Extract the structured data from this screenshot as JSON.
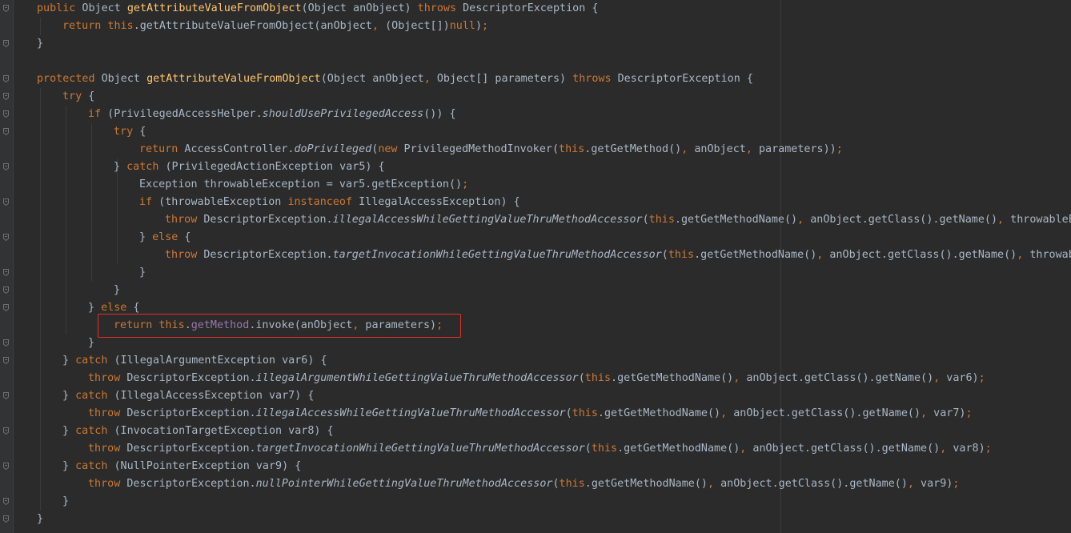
{
  "editor": {
    "colors": {
      "background": "#2b2b2b",
      "gutter": "#313335",
      "keyword": "#cc7832",
      "method_declaration": "#ffc66d",
      "field": "#9876aa",
      "text": "#a9b7c6",
      "highlight_box": "#e0302a"
    },
    "fold_icons": [
      "fold-marker-icon"
    ],
    "lines": [
      {
        "tokens": [
          {
            "t": "kw",
            "v": "public"
          },
          {
            "t": "tx",
            "v": " Object "
          },
          {
            "t": "fn",
            "v": "getAttributeValueFromObject"
          },
          {
            "t": "tx",
            "v": "(Object anObject) "
          },
          {
            "t": "kw",
            "v": "throws"
          },
          {
            "t": "tx",
            "v": " DescriptorException {"
          }
        ]
      },
      {
        "tokens": [
          {
            "t": "kw",
            "v": "return this"
          },
          {
            "t": "tx",
            "v": ".getAttributeValueFromObject(anObject"
          },
          {
            "t": "kw",
            "v": ","
          },
          {
            "t": "tx",
            "v": " (Object[])"
          },
          {
            "t": "kw",
            "v": "null"
          },
          {
            "t": "tx",
            "v": ")"
          },
          {
            "t": "kw",
            "v": ";"
          }
        ]
      },
      {
        "tokens": [
          {
            "t": "tx",
            "v": "}"
          }
        ]
      },
      {
        "tokens": []
      },
      {
        "tokens": [
          {
            "t": "kw",
            "v": "protected"
          },
          {
            "t": "tx",
            "v": " Object "
          },
          {
            "t": "fn",
            "v": "getAttributeValueFromObject"
          },
          {
            "t": "tx",
            "v": "(Object anObject"
          },
          {
            "t": "kw",
            "v": ","
          },
          {
            "t": "tx",
            "v": " Object[] parameters) "
          },
          {
            "t": "kw",
            "v": "throws"
          },
          {
            "t": "tx",
            "v": " DescriptorException {"
          }
        ]
      },
      {
        "tokens": [
          {
            "t": "kw",
            "v": "try"
          },
          {
            "t": "tx",
            "v": " {"
          }
        ]
      },
      {
        "tokens": [
          {
            "t": "kw",
            "v": "if"
          },
          {
            "t": "tx",
            "v": " (PrivilegedAccessHelper."
          },
          {
            "t": "st",
            "v": "shouldUsePrivilegedAccess"
          },
          {
            "t": "tx",
            "v": "()) {"
          }
        ]
      },
      {
        "tokens": [
          {
            "t": "kw",
            "v": "try"
          },
          {
            "t": "tx",
            "v": " {"
          }
        ]
      },
      {
        "tokens": [
          {
            "t": "kw",
            "v": "return"
          },
          {
            "t": "tx",
            "v": " AccessController."
          },
          {
            "t": "st",
            "v": "doPrivileged"
          },
          {
            "t": "tx",
            "v": "("
          },
          {
            "t": "kw",
            "v": "new"
          },
          {
            "t": "tx",
            "v": " PrivilegedMethodInvoker("
          },
          {
            "t": "kw",
            "v": "this"
          },
          {
            "t": "tx",
            "v": ".getGetMethod()"
          },
          {
            "t": "kw",
            "v": ","
          },
          {
            "t": "tx",
            "v": " anObject"
          },
          {
            "t": "kw",
            "v": ","
          },
          {
            "t": "tx",
            "v": " parameters))"
          },
          {
            "t": "kw",
            "v": ";"
          }
        ]
      },
      {
        "tokens": [
          {
            "t": "tx",
            "v": "} "
          },
          {
            "t": "kw",
            "v": "catch"
          },
          {
            "t": "tx",
            "v": " (PrivilegedActionException var5) {"
          }
        ]
      },
      {
        "tokens": [
          {
            "t": "tx",
            "v": "Exception throwableException = var5.getException()"
          },
          {
            "t": "kw",
            "v": ";"
          }
        ]
      },
      {
        "tokens": [
          {
            "t": "kw",
            "v": "if"
          },
          {
            "t": "tx",
            "v": " (throwableException "
          },
          {
            "t": "kw",
            "v": "instanceof"
          },
          {
            "t": "tx",
            "v": " IllegalAccessException) {"
          }
        ]
      },
      {
        "tokens": [
          {
            "t": "kw",
            "v": "throw"
          },
          {
            "t": "tx",
            "v": " DescriptorException."
          },
          {
            "t": "st",
            "v": "illegalAccessWhileGettingValueThruMethodAccessor"
          },
          {
            "t": "tx",
            "v": "("
          },
          {
            "t": "kw",
            "v": "this"
          },
          {
            "t": "tx",
            "v": ".getGetMethodName()"
          },
          {
            "t": "kw",
            "v": ","
          },
          {
            "t": "tx",
            "v": " anObject.getClass().getName()"
          },
          {
            "t": "kw",
            "v": ","
          },
          {
            "t": "tx",
            "v": " throwableEx"
          }
        ]
      },
      {
        "tokens": [
          {
            "t": "tx",
            "v": "} "
          },
          {
            "t": "kw",
            "v": "else"
          },
          {
            "t": "tx",
            "v": " {"
          }
        ]
      },
      {
        "tokens": [
          {
            "t": "kw",
            "v": "throw"
          },
          {
            "t": "tx",
            "v": " DescriptorException."
          },
          {
            "t": "st",
            "v": "targetInvocationWhileGettingValueThruMethodAccessor"
          },
          {
            "t": "tx",
            "v": "("
          },
          {
            "t": "kw",
            "v": "this"
          },
          {
            "t": "tx",
            "v": ".getGetMethodName()"
          },
          {
            "t": "kw",
            "v": ","
          },
          {
            "t": "tx",
            "v": " anObject.getClass().getName()"
          },
          {
            "t": "kw",
            "v": ","
          },
          {
            "t": "tx",
            "v": " throwab"
          }
        ]
      },
      {
        "tokens": [
          {
            "t": "tx",
            "v": "}"
          }
        ]
      },
      {
        "tokens": [
          {
            "t": "tx",
            "v": "}"
          }
        ]
      },
      {
        "tokens": [
          {
            "t": "tx",
            "v": "} "
          },
          {
            "t": "kw",
            "v": "else"
          },
          {
            "t": "tx",
            "v": " {"
          }
        ]
      },
      {
        "tokens": [
          {
            "t": "kw",
            "v": "return this"
          },
          {
            "t": "tx",
            "v": "."
          },
          {
            "t": "fld",
            "v": "getMethod"
          },
          {
            "t": "tx",
            "v": ".invoke(anObject"
          },
          {
            "t": "kw",
            "v": ","
          },
          {
            "t": "tx",
            "v": " parameters)"
          },
          {
            "t": "kw",
            "v": ";"
          }
        ]
      },
      {
        "tokens": [
          {
            "t": "tx",
            "v": "}"
          }
        ]
      },
      {
        "tokens": [
          {
            "t": "tx",
            "v": "} "
          },
          {
            "t": "kw",
            "v": "catch"
          },
          {
            "t": "tx",
            "v": " (IllegalArgumentException var6) {"
          }
        ]
      },
      {
        "tokens": [
          {
            "t": "kw",
            "v": "throw"
          },
          {
            "t": "tx",
            "v": " DescriptorException."
          },
          {
            "t": "st",
            "v": "illegalArgumentWhileGettingValueThruMethodAccessor"
          },
          {
            "t": "tx",
            "v": "("
          },
          {
            "t": "kw",
            "v": "this"
          },
          {
            "t": "tx",
            "v": ".getGetMethodName()"
          },
          {
            "t": "kw",
            "v": ","
          },
          {
            "t": "tx",
            "v": " anObject.getClass().getName()"
          },
          {
            "t": "kw",
            "v": ","
          },
          {
            "t": "tx",
            "v": " var6)"
          },
          {
            "t": "kw",
            "v": ";"
          }
        ]
      },
      {
        "tokens": [
          {
            "t": "tx",
            "v": "} "
          },
          {
            "t": "kw",
            "v": "catch"
          },
          {
            "t": "tx",
            "v": " (IllegalAccessException var7) {"
          }
        ]
      },
      {
        "tokens": [
          {
            "t": "kw",
            "v": "throw"
          },
          {
            "t": "tx",
            "v": " DescriptorException."
          },
          {
            "t": "st",
            "v": "illegalAccessWhileGettingValueThruMethodAccessor"
          },
          {
            "t": "tx",
            "v": "("
          },
          {
            "t": "kw",
            "v": "this"
          },
          {
            "t": "tx",
            "v": ".getGetMethodName()"
          },
          {
            "t": "kw",
            "v": ","
          },
          {
            "t": "tx",
            "v": " anObject.getClass().getName()"
          },
          {
            "t": "kw",
            "v": ","
          },
          {
            "t": "tx",
            "v": " var7)"
          },
          {
            "t": "kw",
            "v": ";"
          }
        ]
      },
      {
        "tokens": [
          {
            "t": "tx",
            "v": "} "
          },
          {
            "t": "kw",
            "v": "catch"
          },
          {
            "t": "tx",
            "v": " (InvocationTargetException var8) {"
          }
        ]
      },
      {
        "tokens": [
          {
            "t": "kw",
            "v": "throw"
          },
          {
            "t": "tx",
            "v": " DescriptorException."
          },
          {
            "t": "st",
            "v": "targetInvocationWhileGettingValueThruMethodAccessor"
          },
          {
            "t": "tx",
            "v": "("
          },
          {
            "t": "kw",
            "v": "this"
          },
          {
            "t": "tx",
            "v": ".getGetMethodName()"
          },
          {
            "t": "kw",
            "v": ","
          },
          {
            "t": "tx",
            "v": " anObject.getClass().getName()"
          },
          {
            "t": "kw",
            "v": ","
          },
          {
            "t": "tx",
            "v": " var8)"
          },
          {
            "t": "kw",
            "v": ";"
          }
        ]
      },
      {
        "tokens": [
          {
            "t": "tx",
            "v": "} "
          },
          {
            "t": "kw",
            "v": "catch"
          },
          {
            "t": "tx",
            "v": " (NullPointerException var9) {"
          }
        ]
      },
      {
        "tokens": [
          {
            "t": "kw",
            "v": "throw"
          },
          {
            "t": "tx",
            "v": " DescriptorException."
          },
          {
            "t": "st",
            "v": "nullPointerWhileGettingValueThruMethodAccessor"
          },
          {
            "t": "tx",
            "v": "("
          },
          {
            "t": "kw",
            "v": "this"
          },
          {
            "t": "tx",
            "v": ".getGetMethodName()"
          },
          {
            "t": "kw",
            "v": ","
          },
          {
            "t": "tx",
            "v": " anObject.getClass().getName()"
          },
          {
            "t": "kw",
            "v": ","
          },
          {
            "t": "tx",
            "v": " var9)"
          },
          {
            "t": "kw",
            "v": ";"
          }
        ]
      },
      {
        "tokens": [
          {
            "t": "tx",
            "v": "}"
          }
        ]
      },
      {
        "tokens": [
          {
            "t": "tx",
            "v": "}"
          }
        ]
      }
    ]
  }
}
